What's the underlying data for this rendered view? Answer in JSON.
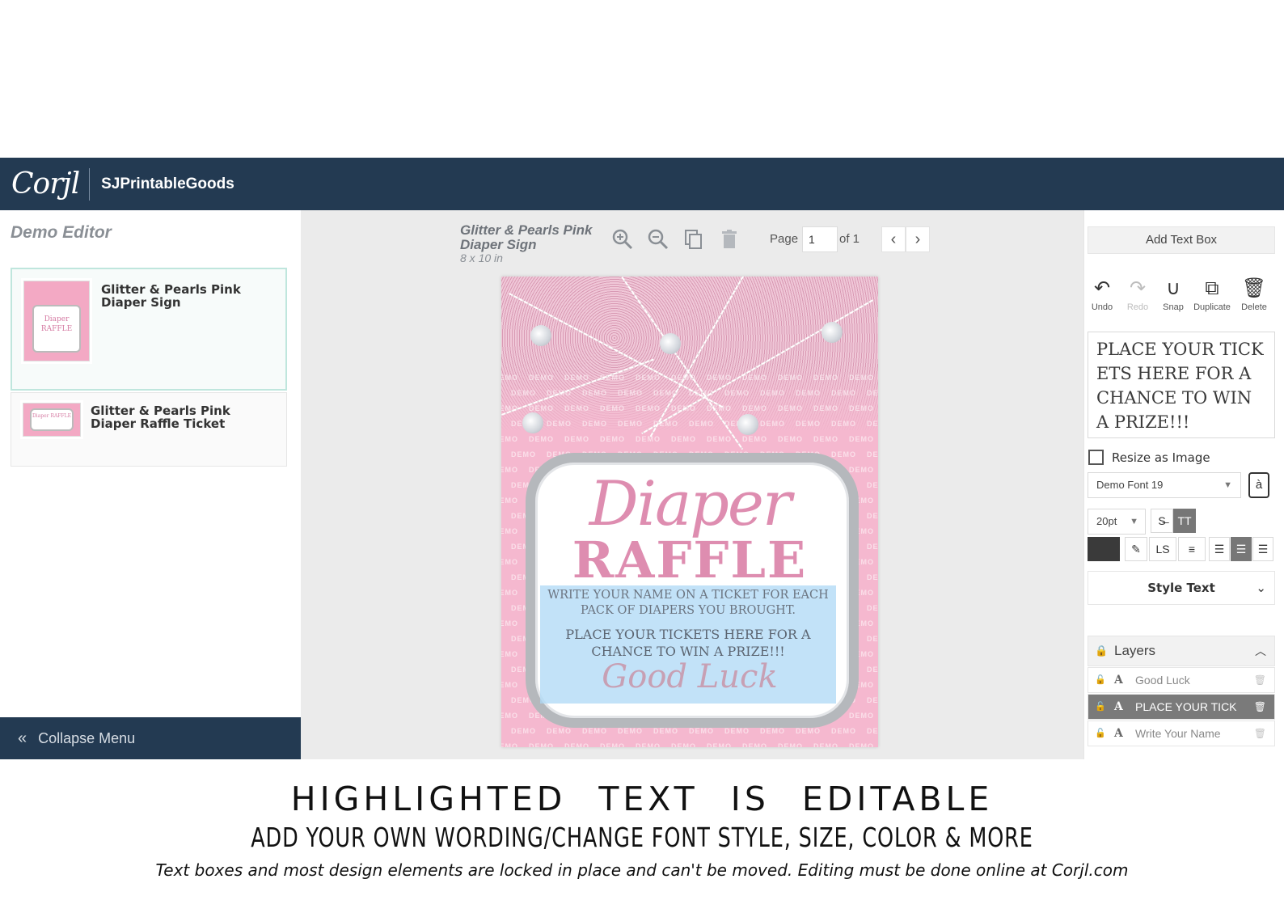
{
  "header": {
    "logo": "Corjl",
    "shop_name": "SJPrintableGoods"
  },
  "left_panel": {
    "title": "Demo Editor",
    "documents": [
      {
        "label": "Glitter & Pearls Pink Diaper Sign",
        "thumb_text": "Diaper RAFFLE",
        "active": true
      },
      {
        "label": "Glitter & Pearls Pink Diaper Raffle Ticket",
        "thumb_text": "Diaper RAFFLE",
        "active": false
      }
    ],
    "collapse_label": "Collapse Menu"
  },
  "center": {
    "project_title": "Glitter & Pearls Pink Diaper Sign",
    "project_size": "8 x 10 in",
    "page_label": "Page",
    "page_value": "1",
    "of_label": "of 1",
    "canvas": {
      "watermark": "DEMO",
      "title_script": "Diaper",
      "title_main": "RAFFLE",
      "line1": "WRITE YOUR NAME ON A TICKET FOR EACH PACK OF DIAPERS YOU BROUGHT.",
      "line2": "PLACE YOUR TICKETS HERE FOR A CHANCE TO WIN A PRIZE!!!",
      "sign_off": "Good Luck",
      "colors": {
        "background": "#f5b8cf",
        "title": "#de8db0",
        "selection": "#add8f5"
      }
    }
  },
  "right_panel": {
    "add_text_box": "Add Text Box",
    "toolbar": {
      "undo": "Undo",
      "redo": "Redo",
      "snap": "Snap",
      "duplicate": "Duplicate",
      "delete": "Delete"
    },
    "text_value": "PLACE YOUR TICKETS HERE FOR A CHANCE TO WIN A PRIZE!!!",
    "resize_label": "Resize as Image",
    "font": "Demo Font 19",
    "glyph_button": "à",
    "size": "20pt",
    "style_text": "Style Text",
    "layers_title": "Layers",
    "layers": [
      {
        "name": "Good Luck",
        "selected": false
      },
      {
        "name": "PLACE YOUR TICK",
        "selected": true
      },
      {
        "name": "Write Your Name",
        "selected": false
      }
    ],
    "text_color": "#3a3a3a"
  },
  "captions": {
    "line1": "HIGHLIGHTED TEXT IS EDITABLE",
    "line2": "ADD YOUR OWN WORDING/CHANGE FONT STYLE, SIZE, COLOR & MORE",
    "line3": "Text boxes and most design elements are locked in place and can't be moved. Editing must be done online at Corjl.com"
  }
}
